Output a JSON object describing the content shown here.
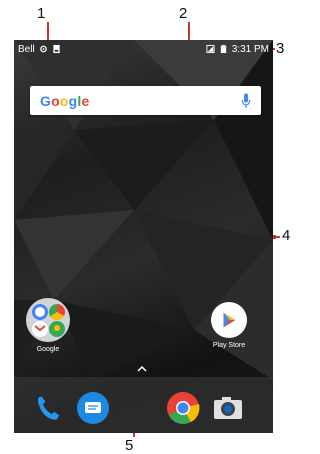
{
  "callouts": [
    "1",
    "2",
    "3",
    "4",
    "5"
  ],
  "status_bar": {
    "carrier": "Bell",
    "time": "3:31 PM"
  },
  "search": {
    "logo_letters": [
      "G",
      "o",
      "o",
      "g",
      "l",
      "e"
    ],
    "logo_colors": [
      "#4285F4",
      "#EA4335",
      "#FBBC05",
      "#4285F4",
      "#34A853",
      "#EA4335"
    ]
  },
  "apps": {
    "folder_label": "Google",
    "play_store_label": "Play Store"
  },
  "dock": {
    "items": [
      "phone-icon",
      "messages-icon",
      "chrome-icon",
      "camera-icon"
    ]
  },
  "colors": {
    "callout": "#c0392b",
    "phone_blue": "#2196F3",
    "messages_blue": "#1E88E5"
  }
}
